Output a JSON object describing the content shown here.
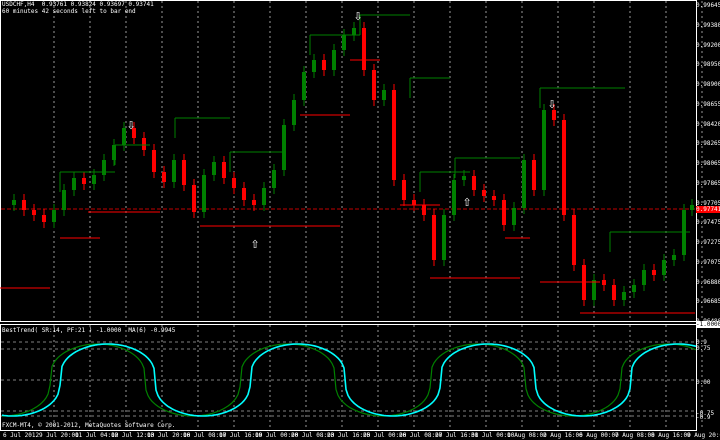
{
  "header": {
    "symbol_line": "USDCHF,H4  0.93761 0.93824 0.93697 0.93741",
    "timer_line": "60 minutes 42 seconds left to bar end"
  },
  "indicator": {
    "title": "BestTrend( SR:14, PF:21 ) -1.0000  MA(6) -0.9945"
  },
  "footer": {
    "copyright": "FXCM-MT4, © 2001-2012, MetaQuotes Software Corp."
  },
  "price_axis": {
    "labels": [
      "0.99645",
      "0.99380",
      "0.99200",
      "0.98950",
      "0.98900",
      "0.98655",
      "0.98420",
      "0.98265",
      "0.98065",
      "0.97865",
      "0.97705",
      "0.97475",
      "0.97275",
      "0.97075",
      "0.96880",
      "0.96685",
      "0.96480"
    ],
    "current_price": "0.97741"
  },
  "indicator_axis": {
    "labels": [
      "0.9",
      "0.75",
      "0.00",
      "-0.75",
      "-0.9",
      "-1.0000"
    ]
  },
  "time_axis": {
    "labels": [
      "6 Jul 2012",
      "9 Jul 20:00",
      "11 Jul 04:00",
      "12 Jul 12:00",
      "13 Jul 20:00",
      "16 Jul 08:00",
      "17 Jul 16:00",
      "19 Jul 00:00",
      "20 Jul 08:00",
      "23 Jul 16:00",
      "25 Jul 00:00",
      "26 Jul 08:00",
      "27 Jul 16:00",
      "31 Jul 00:00",
      "1 Aug 08:00",
      "2 Aug 16:00",
      "6 Aug 00:00",
      "7 Aug 08:00",
      "8 Aug 16:00",
      "9 Aug 20:00"
    ]
  },
  "arrows": {
    "down_label": "⇩",
    "up_label": "⇧"
  },
  "colors": {
    "background": "#000000",
    "bull_candle": "#008000",
    "bear_candle": "#ff0000",
    "grid": "#ffffff",
    "support_line": "#ff0000",
    "resistance_line": "#008000",
    "signal_line": "#00ffff",
    "trend_line": "#008000"
  }
}
